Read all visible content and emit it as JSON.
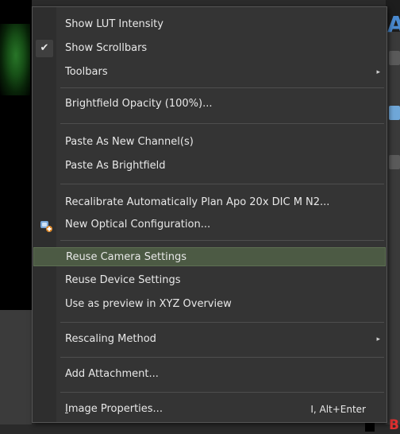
{
  "menu": {
    "items": {
      "show_lut_intensity": "Show LUT Intensity",
      "show_scrollbars": "Show Scrollbars",
      "toolbars": "Toolbars",
      "brightfield_opacity": "Brightfield Opacity (100%)...",
      "paste_new_channel": "Paste As New Channel(s)",
      "paste_brightfield": "Paste As Brightfield",
      "recalibrate": "Recalibrate Automatically Plan Apo 20x DIC M N2...",
      "new_optical_config": "New Optical Configuration...",
      "reuse_camera": "Reuse Camera Settings",
      "reuse_device": "Reuse Device Settings",
      "use_preview_xyz": "Use as preview in XYZ Overview",
      "rescaling_method": "Rescaling Method",
      "add_attachment": "Add Attachment...",
      "image_properties_first": "I",
      "image_properties_rest": "mage Properties...",
      "image_properties_shortcut": "I, Alt+Enter"
    },
    "checked": [
      "show_scrollbars"
    ],
    "highlighted": "reuse_camera",
    "check_glyph": "✔",
    "submenu_glyph": "▸"
  },
  "background": {
    "corner_letter": "B",
    "top_right_letter": "A"
  },
  "colors": {
    "menu_bg": "#343434",
    "highlight": "#4c5a44",
    "text": "#e8e8e8"
  }
}
